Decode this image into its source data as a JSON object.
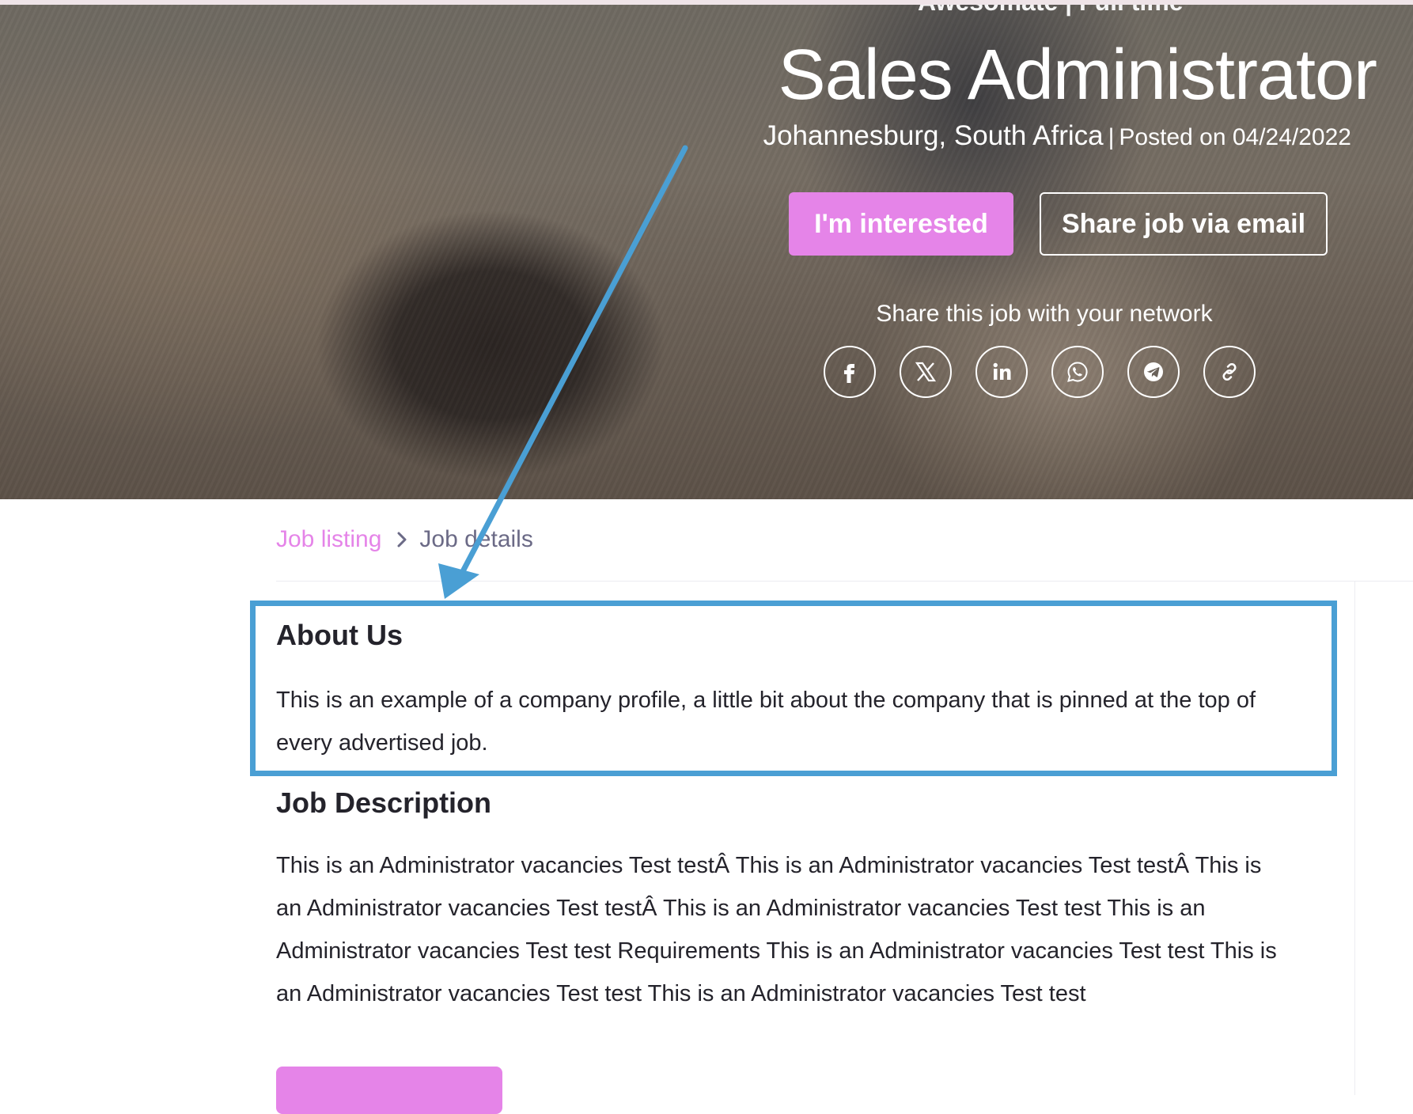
{
  "hero": {
    "company_line": "Awesomate | Full time",
    "title": "Sales Administrator",
    "location": "Johannesburg, South Africa",
    "separator": "|",
    "posted": "Posted on 04/24/2022",
    "interested_button": "I'm interested",
    "share_email_button": "Share job via email",
    "share_label": "Share this job with your network",
    "social_icons": [
      "facebook-icon",
      "x-icon",
      "linkedin-icon",
      "whatsapp-icon",
      "telegram-icon",
      "link-icon"
    ]
  },
  "breadcrumb": {
    "link": "Job listing",
    "current": "Job details"
  },
  "about": {
    "heading": "About Us",
    "text": "This is an example of a company profile, a little bit about the company that is pinned at the top of every advertised job."
  },
  "description": {
    "heading": "Job Description",
    "text": "This is an Administrator vacancies Test testÂ  This is an Administrator vacancies Test testÂ  This is an Administrator vacancies Test testÂ  This is an Administrator vacancies Test test This is an Administrator vacancies Test test Requirements This is an Administrator vacancies Test test This is an Administrator vacancies Test test This is an Administrator vacancies Test test"
  },
  "colors": {
    "accent": "#e584e8",
    "annotation": "#4a9fd4",
    "breadcrumb_current": "#6b6a86"
  }
}
